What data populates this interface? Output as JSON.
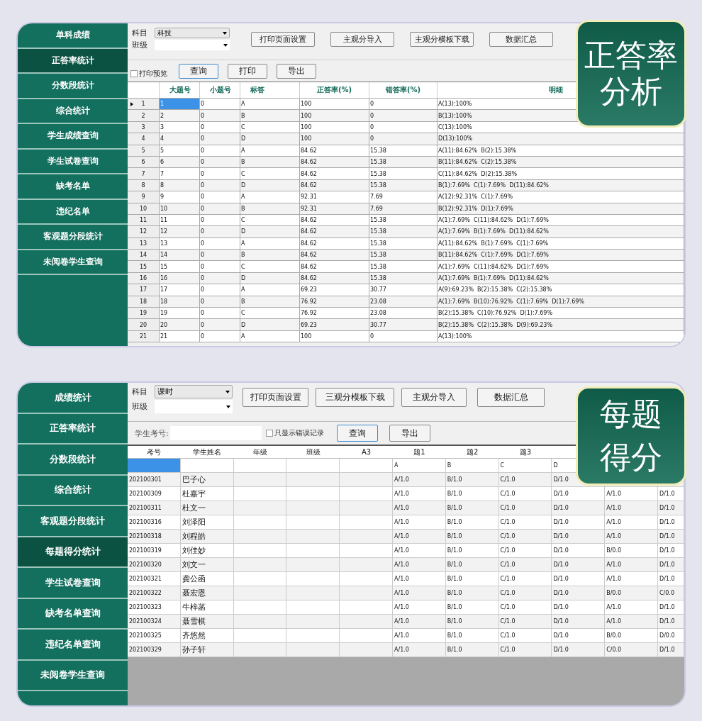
{
  "panel_1": {
    "badge": [
      "正答率",
      "分析"
    ],
    "sidebar": [
      {
        "label": "单科成绩",
        "selected": false
      },
      {
        "label": "正答率统计",
        "selected": true
      },
      {
        "label": "分数段统计",
        "selected": false
      },
      {
        "label": "综合统计",
        "selected": false
      },
      {
        "label": "学生成绩查询",
        "selected": false
      },
      {
        "label": "学生试卷查询",
        "selected": false
      },
      {
        "label": "缺考名单",
        "selected": false
      },
      {
        "label": "违纪名单",
        "selected": false
      },
      {
        "label": "客观题分段统计",
        "selected": false
      },
      {
        "label": "未阅卷学生查询",
        "selected": false
      }
    ],
    "filters": [
      {
        "label": "科目",
        "value": "科技"
      },
      {
        "label": "班级"
      }
    ],
    "buttons": [
      "打印页面设置",
      "主观分导入",
      "主观分横板下载",
      "数据汇总"
    ],
    "print_preview": {
      "label": "打印预览",
      "checked": false
    },
    "actions": [
      {
        "label": "查询",
        "focused": true
      },
      {
        "label": "打印",
        "focused": false
      },
      {
        "label": "导出",
        "focused": false
      }
    ],
    "columns": [
      "大题号",
      "小题号",
      "标答",
      "正答率(%)",
      "错答率(%)",
      "明细"
    ],
    "rows": [
      {
        "current": true,
        "cells": [
          "1",
          "1",
          "0",
          "A",
          "100",
          "0",
          "A(13):100%"
        ]
      },
      {
        "current": false,
        "cells": [
          "2",
          "2",
          "0",
          "B",
          "100",
          "0",
          "B(13):100%"
        ]
      },
      {
        "current": false,
        "cells": [
          "3",
          "3",
          "0",
          "C",
          "100",
          "0",
          "C(13):100%"
        ]
      },
      {
        "current": false,
        "cells": [
          "4",
          "4",
          "0",
          "D",
          "100",
          "0",
          "D(13):100%"
        ]
      },
      {
        "current": false,
        "cells": [
          "5",
          "5",
          "0",
          "A",
          "84.62",
          "15.38",
          "A(11):84.62%  B(2):15.38%"
        ]
      },
      {
        "current": false,
        "cells": [
          "6",
          "6",
          "0",
          "B",
          "84.62",
          "15.38",
          "B(11):84.62%  C(2):15.38%"
        ]
      },
      {
        "current": false,
        "cells": [
          "7",
          "7",
          "0",
          "C",
          "84.62",
          "15.38",
          "C(11):84.62%  D(2):15.38%"
        ]
      },
      {
        "current": false,
        "cells": [
          "8",
          "8",
          "0",
          "D",
          "84.62",
          "15.38",
          "B(1):7.69%  C(1):7.69%  D(11):84.62%"
        ]
      },
      {
        "current": false,
        "cells": [
          "9",
          "9",
          "0",
          "A",
          "92.31",
          "7.69",
          "A(12):92.31%  C(1):7.69%"
        ]
      },
      {
        "current": false,
        "cells": [
          "10",
          "10",
          "0",
          "B",
          "92.31",
          "7.69",
          "B(12):92.31%  D(1):7.69%"
        ]
      },
      {
        "current": false,
        "cells": [
          "11",
          "11",
          "0",
          "C",
          "84.62",
          "15.38",
          "A(1):7.69%  C(11):84.62%  D(1):7.69%"
        ]
      },
      {
        "current": false,
        "cells": [
          "12",
          "12",
          "0",
          "D",
          "84.62",
          "15.38",
          "A(1):7.69%  B(1):7.69%  D(11):84.62%"
        ]
      },
      {
        "current": false,
        "cells": [
          "13",
          "13",
          "0",
          "A",
          "84.62",
          "15.38",
          "A(11):84.62%  B(1):7.69%  C(1):7.69%"
        ]
      },
      {
        "current": false,
        "cells": [
          "14",
          "14",
          "0",
          "B",
          "84.62",
          "15.38",
          "B(11):84.62%  C(1):7.69%  D(1):7.69%"
        ]
      },
      {
        "current": false,
        "cells": [
          "15",
          "15",
          "0",
          "C",
          "84.62",
          "15.38",
          "A(1):7.69%  C(11):84.62%  D(1):7.69%"
        ]
      },
      {
        "current": false,
        "cells": [
          "16",
          "16",
          "0",
          "D",
          "84.62",
          "15.38",
          "A(1):7.69%  B(1):7.69%  D(11):84.62%"
        ]
      },
      {
        "current": false,
        "cells": [
          "17",
          "17",
          "0",
          "A",
          "69.23",
          "30.77",
          "A(9):69.23%  B(2):15.38%  C(2):15.38%"
        ]
      },
      {
        "current": false,
        "cells": [
          "18",
          "18",
          "0",
          "B",
          "76.92",
          "23.08",
          "A(1):7.69%  B(10):76.92%  C(1):7.69%  D(1):7.69%"
        ]
      },
      {
        "current": false,
        "cells": [
          "19",
          "19",
          "0",
          "C",
          "76.92",
          "23.08",
          "B(2):15.38%  C(10):76.92%  D(1):7.69%"
        ]
      },
      {
        "current": false,
        "cells": [
          "20",
          "20",
          "0",
          "D",
          "69.23",
          "30.77",
          "B(2):15.38%  C(2):15.38%  D(9):69.23%"
        ]
      },
      {
        "current": false,
        "cells": [
          "21",
          "21",
          "0",
          "A",
          "100",
          "0",
          "A(13):100%"
        ]
      }
    ]
  },
  "panel_2": {
    "badge": [
      "每题",
      "得分"
    ],
    "sidebar": [
      {
        "label": "成绩统计",
        "selected": false
      },
      {
        "label": "正答率统计",
        "selected": false
      },
      {
        "label": "分数段统计",
        "selected": false
      },
      {
        "label": "综合统计",
        "selected": false
      },
      {
        "label": "客观题分段统计",
        "selected": false
      },
      {
        "label": "每题得分统计",
        "selected": true
      },
      {
        "label": "学生试卷查询",
        "selected": false
      },
      {
        "label": "缺考名单查询",
        "selected": false
      },
      {
        "label": "违纪名单查询",
        "selected": false
      },
      {
        "label": "未阅卷学生查询",
        "selected": false
      }
    ],
    "filters": [
      {
        "label": "科目",
        "value": "课时"
      },
      {
        "label": "班级"
      }
    ],
    "buttons": [
      "打印页面设置",
      "三观分模板下载",
      "主观分导入",
      "数据汇总"
    ],
    "student_id": {
      "label": "学生考号:"
    },
    "errors_only": {
      "label": "只显示错误记录",
      "checked": false
    },
    "actions": [
      {
        "label": "查询",
        "focused": true
      },
      {
        "label": "导出",
        "focused": false
      }
    ],
    "columns": [
      "考号",
      "学生姓名",
      "年级",
      "班级",
      "A3",
      "题1",
      "题2",
      "题3"
    ],
    "answer_key": [
      "A",
      "B",
      "C",
      "D"
    ],
    "rows": [
      {
        "id": "202100301",
        "name": "巴子心",
        "answers": [
          "A/1.0",
          "B/1.0",
          "C/1.0",
          "D/1.0"
        ]
      },
      {
        "id": "202100309",
        "name": "杜嘉宇",
        "answers": [
          "A/1.0",
          "B/1.0",
          "C/1.0",
          "D/1.0",
          "A/1.0",
          "D/1.0"
        ]
      },
      {
        "id": "202100311",
        "name": "杜文一",
        "answers": [
          "A/1.0",
          "B/1.0",
          "C/1.0",
          "D/1.0",
          "A/1.0",
          "D/1.0"
        ]
      },
      {
        "id": "202100316",
        "name": "刘泽阳",
        "answers": [
          "A/1.0",
          "B/1.0",
          "C/1.0",
          "D/1.0",
          "A/1.0",
          "D/1.0"
        ]
      },
      {
        "id": "202100318",
        "name": "刘程皓",
        "answers": [
          "A/1.0",
          "B/1.0",
          "C/1.0",
          "D/1.0",
          "A/1.0",
          "D/1.0"
        ]
      },
      {
        "id": "202100319",
        "name": "刘佳妙",
        "answers": [
          "A/1.0",
          "B/1.0",
          "C/1.0",
          "D/1.0",
          "B/0.0",
          "D/1.0"
        ]
      },
      {
        "id": "202100320",
        "name": "刘文一",
        "answers": [
          "A/1.0",
          "B/1.0",
          "C/1.0",
          "D/1.0",
          "A/1.0",
          "D/1.0"
        ]
      },
      {
        "id": "202100321",
        "name": "龚公函",
        "answers": [
          "A/1.0",
          "B/1.0",
          "C/1.0",
          "D/1.0",
          "A/1.0",
          "D/1.0"
        ]
      },
      {
        "id": "202100322",
        "name": "聂宏恩",
        "answers": [
          "A/1.0",
          "B/1.0",
          "C/1.0",
          "D/1.0",
          "B/0.0",
          "C/0.0"
        ]
      },
      {
        "id": "202100323",
        "name": "牛梓菡",
        "answers": [
          "A/1.0",
          "B/1.0",
          "C/1.0",
          "D/1.0",
          "A/1.0",
          "D/1.0"
        ]
      },
      {
        "id": "202100324",
        "name": "聂雪棋",
        "answers": [
          "A/1.0",
          "B/1.0",
          "C/1.0",
          "D/1.0",
          "A/1.0",
          "D/1.0"
        ]
      },
      {
        "id": "202100325",
        "name": "齐悠然",
        "answers": [
          "A/1.0",
          "B/1.0",
          "C/1.0",
          "D/1.0",
          "B/0.0",
          "D/0.0"
        ]
      },
      {
        "id": "202100329",
        "name": "孙子轩",
        "answers": [
          "A/1.0",
          "B/1.0",
          "C/1.0",
          "D/1.0",
          "C/0.0",
          "D/1.0"
        ]
      }
    ]
  }
}
